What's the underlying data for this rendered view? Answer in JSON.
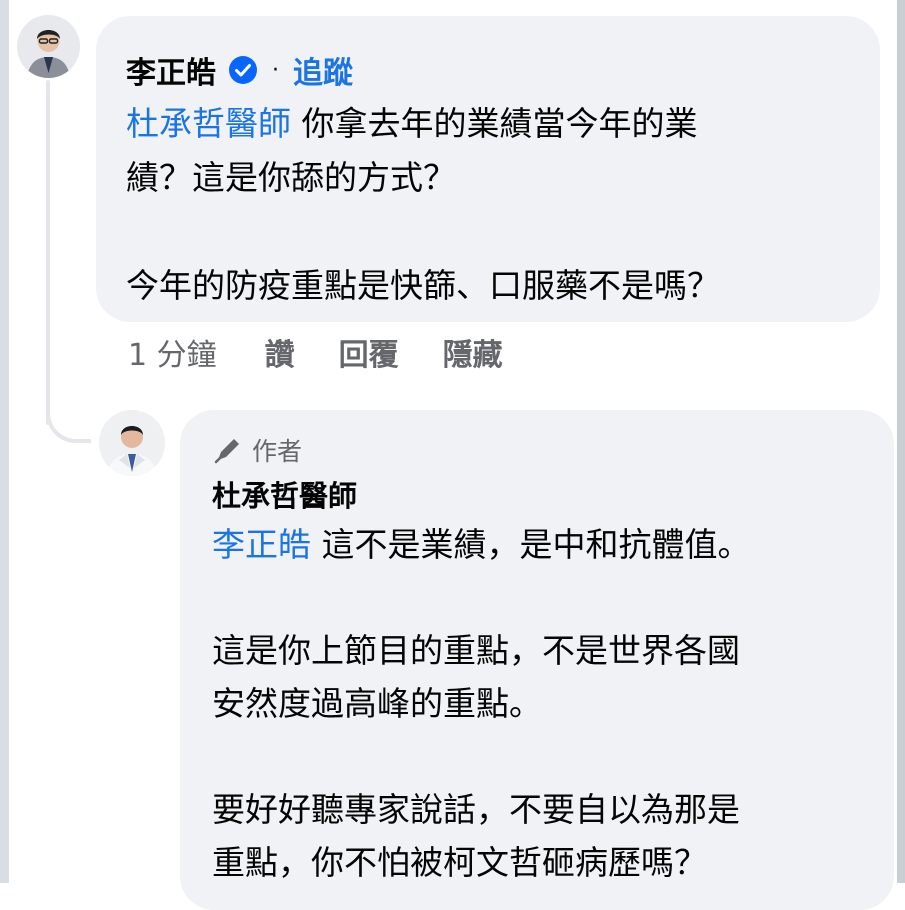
{
  "comment": {
    "author": "李正皓",
    "follow_label": "追蹤",
    "separator": "·",
    "mention": "杜承哲醫師",
    "text": " 你拿去年的業績當今年的業\n績？這是你舔的方式？\n\n今年的防疫重點是快篩、口服藥不是嗎？",
    "time": "1 分鐘",
    "like_label": "讚",
    "reply_label": "回覆",
    "hide_label": "隱藏"
  },
  "reply": {
    "badge": "作者",
    "author": "杜承哲醫師",
    "mention": "李正皓",
    "text": " 這不是業績，是中和抗體值。\n\n這是你上節目的重點，不是世界各國\n安然度過高峰的重點。\n\n要好好聽專家說話，不要自以為那是\n重點，你不怕被柯文哲砸病歷嗎？"
  },
  "colors": {
    "link": "#1b74e4",
    "bubble": "#f0f2f5",
    "secondary_text": "#65676b",
    "verified": "#0866ff"
  },
  "icons": {
    "verified": "verified-badge-icon",
    "author_badge": "pen-icon"
  }
}
